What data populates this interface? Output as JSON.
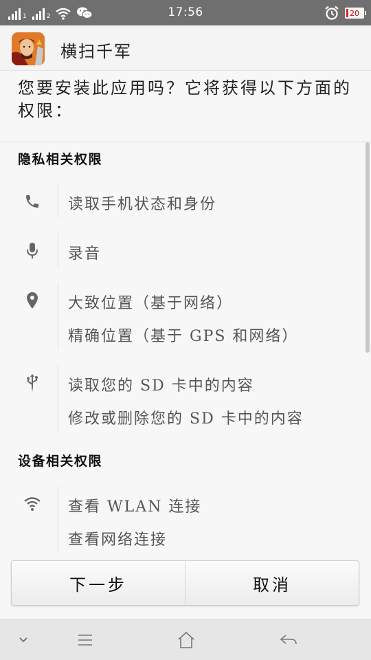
{
  "status_bar": {
    "time": "17:56",
    "sim1_label": "1",
    "sim2_label": "2",
    "battery_level": "20"
  },
  "app": {
    "name": "横扫千军",
    "icon": "app-icon-warrior"
  },
  "install_prompt": "您要安装此应用吗？它将获得以下方面的权限：",
  "sections": {
    "privacy": {
      "title": "隐私相关权限",
      "groups": [
        {
          "icon": "phone-icon",
          "items": [
            "读取手机状态和身份"
          ]
        },
        {
          "icon": "microphone-icon",
          "items": [
            "录音"
          ]
        },
        {
          "icon": "location-pin-icon",
          "items": [
            "大致位置（基于网络）",
            "精确位置（基于 GPS 和网络）"
          ]
        },
        {
          "icon": "usb-icon",
          "items": [
            "读取您的 SD 卡中的内容",
            "修改或删除您的 SD 卡中的内容"
          ]
        }
      ]
    },
    "device": {
      "title": "设备相关权限",
      "groups": [
        {
          "icon": "wifi-icon",
          "items": [
            "查看 WLAN 连接",
            "查看网络连接"
          ]
        }
      ]
    }
  },
  "buttons": {
    "next": "下一步",
    "cancel": "取消"
  },
  "colors": {
    "status_bar": "#6f6f6f",
    "icon_gray": "#666666",
    "battery_low": "#cc0000"
  }
}
